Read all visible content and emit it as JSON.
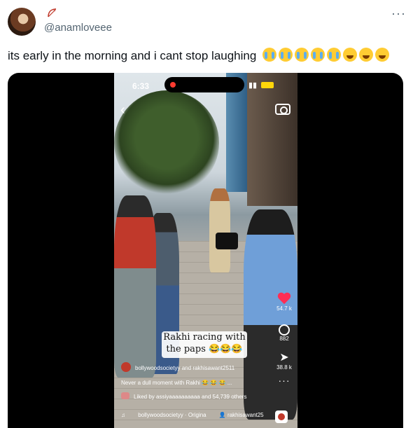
{
  "post": {
    "handle": "@anamloveee",
    "more_label": "···",
    "text": "its early in the morning and i cant stop laughing",
    "emojis": [
      "loudly-crying-face",
      "loudly-crying-face",
      "loudly-crying-face",
      "loudly-crying-face",
      "loudly-crying-face",
      "face-with-tears-of-joy",
      "face-with-tears-of-joy",
      "face-with-tears-of-joy"
    ]
  },
  "video": {
    "status_time": "6:33",
    "battery_label": "83",
    "caption_line1": "Rakhi racing with",
    "caption_line2": "the paps",
    "likes": "54.7 k",
    "comments": "882",
    "shares": "38.8 k",
    "more_label": "···",
    "account": "bollywoodsocietyy",
    "and_label": "and",
    "collaborator": "rakhisawant2511",
    "description": "Never a dull moment with Rakhi 😂 😂 😂 ...",
    "liked_by": "Liked by assiyaaaaaaaaaa and 54,739 others",
    "music_note": "♫",
    "audio": "bollywoodsocietyy · Origina",
    "audio_artist": "rakhisawant25"
  }
}
